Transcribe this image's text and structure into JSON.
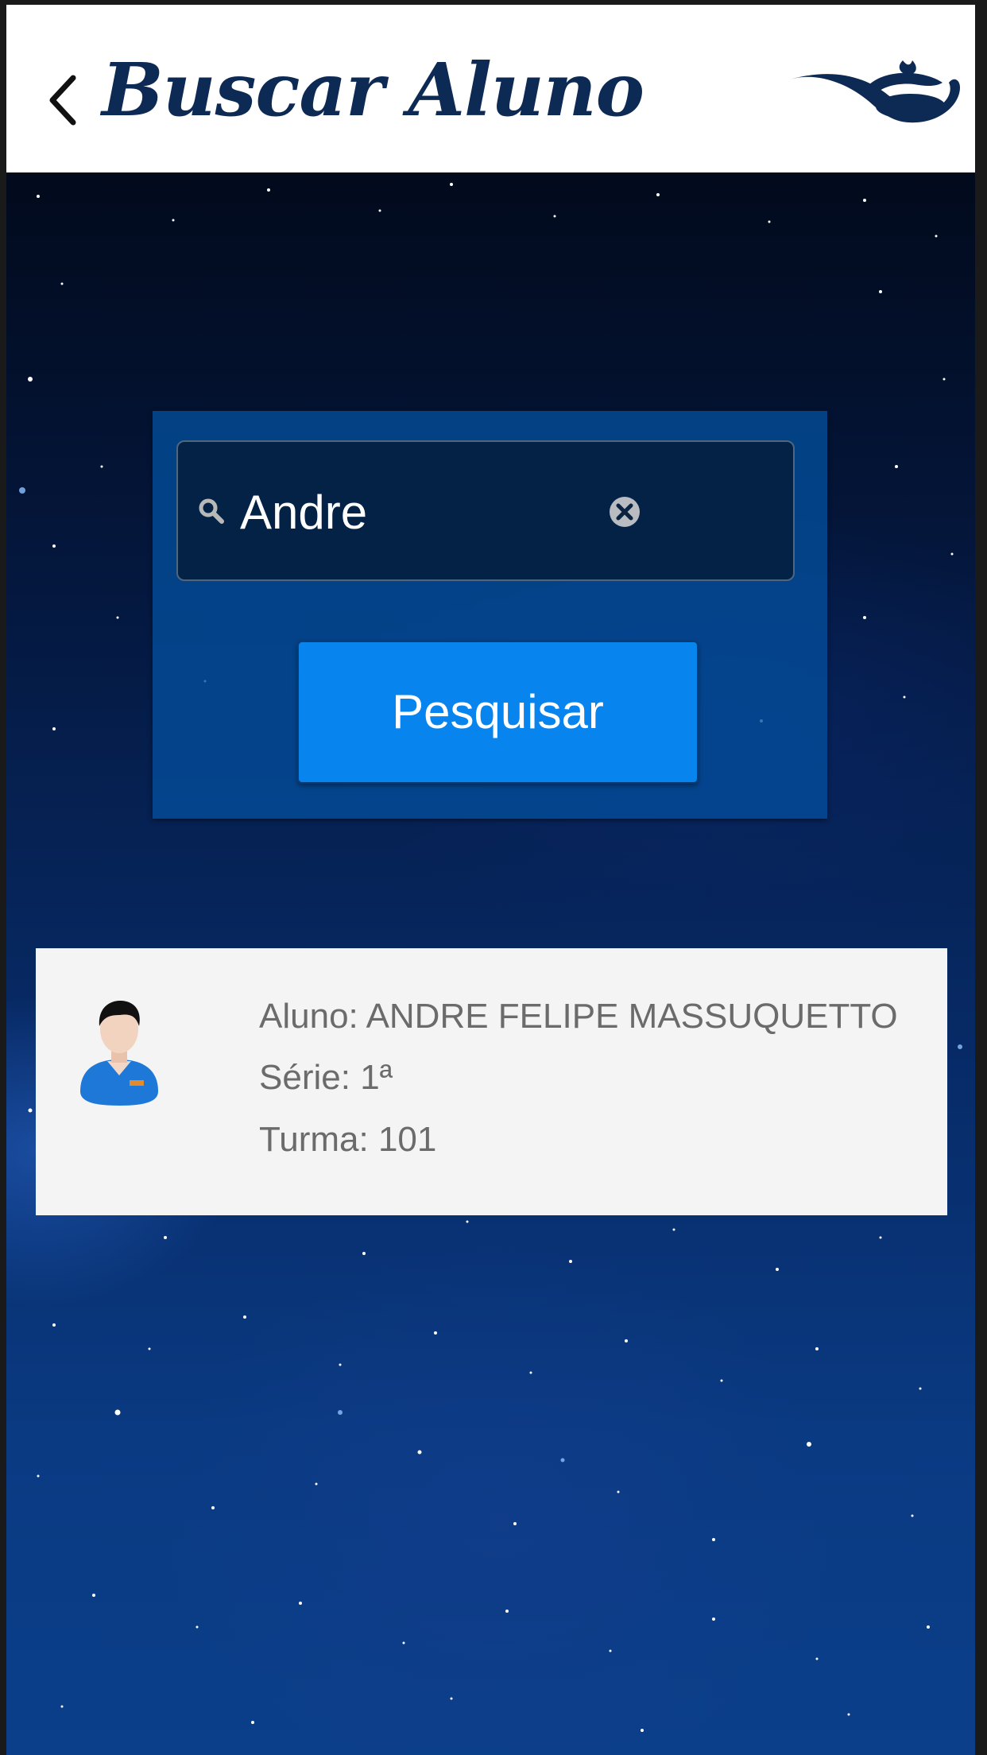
{
  "header": {
    "title": "Buscar Aluno",
    "back_icon": "chevron-left-icon",
    "logo_icon": "lamp-logo-icon",
    "title_color": "#0d2a55"
  },
  "search": {
    "value": "Andre",
    "placeholder": "",
    "search_icon": "search-icon",
    "clear_icon": "clear-circle-icon",
    "button_label": "Pesquisar",
    "button_color": "#0884ee"
  },
  "results": [
    {
      "avatar_icon": "student-avatar-icon",
      "aluno_label": "Aluno:",
      "aluno_value": "ANDRE FELIPE MASSUQUETTO",
      "serie_label": "Série:",
      "serie_value": "1ª",
      "turma_label": "Turma:",
      "turma_value": "101"
    }
  ]
}
